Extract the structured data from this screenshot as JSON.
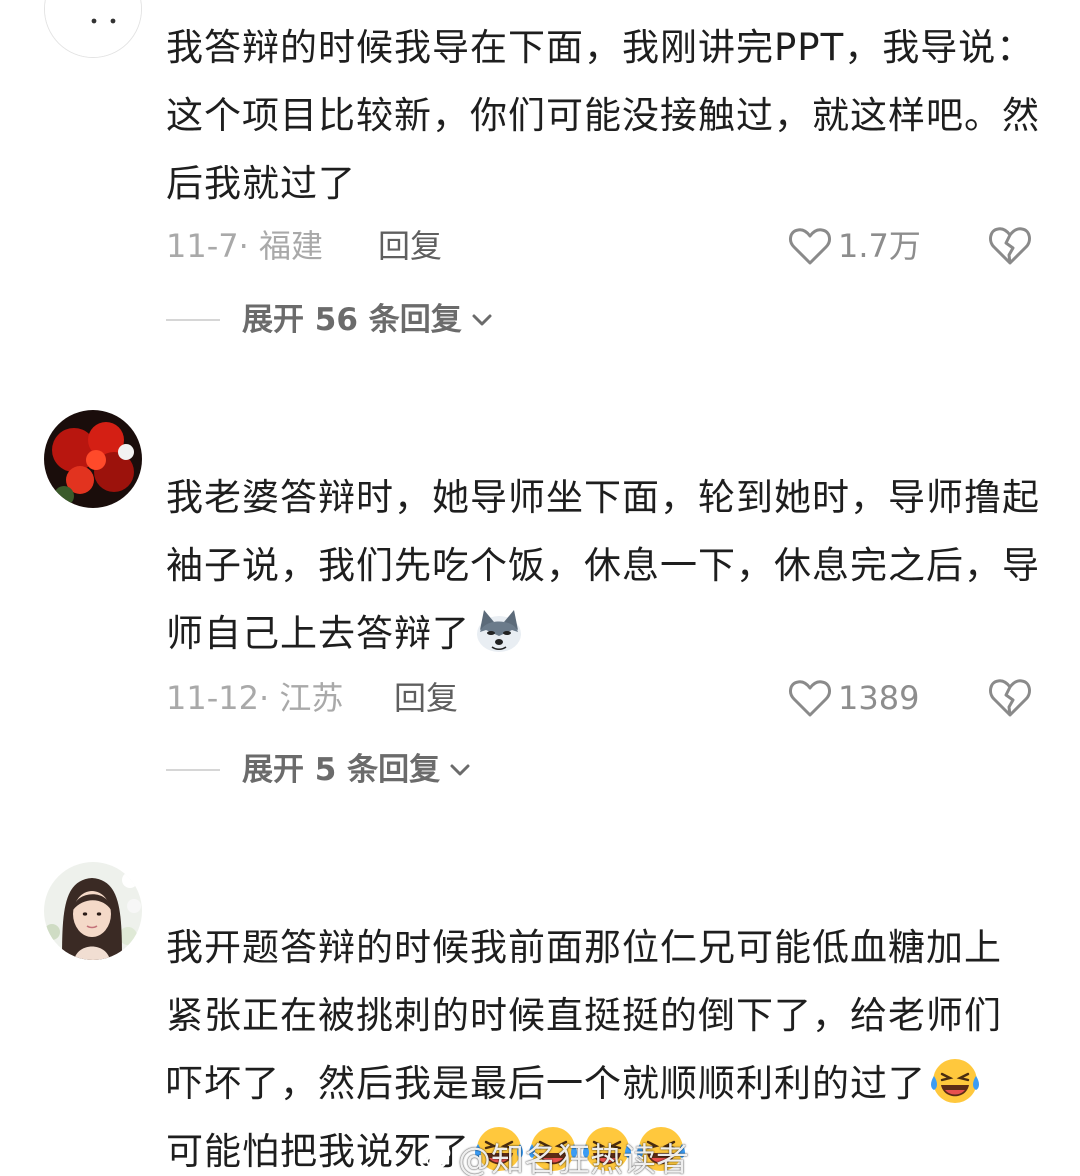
{
  "comments": [
    {
      "text": "我答辩的时候我导在下面，我刚讲完PPT，我导说：这个项目比较新，你们可能没接触过，就这样吧。然后我就过了",
      "date_location": "11-7· 福建",
      "reply_label": "回复",
      "like_count": "1.7万",
      "expand_label": "展开 56 条回复"
    },
    {
      "text": "我老婆答辩时，她导师坐下面，轮到她时，导师撸起袖子说，我们先吃个饭，休息一下，休息完之后，导师自己上去答辩了",
      "emoji_icon": "doge-husky-emoji",
      "date_location": "11-12· 江苏",
      "reply_label": "回复",
      "like_count": "1389",
      "expand_label": "展开 5 条回复"
    },
    {
      "text": "我开题答辩的时候我前面那位仁兄可能低血糖加上紧张正在被挑刺的时候直挺挺的倒下了，给老师们吓坏了，然后我是最后一个就顺顺利利的过了",
      "text_tail": "可能怕把我说死了",
      "emoji_icon": "laughing-crying-emoji"
    }
  ],
  "watermark": "@知名狂热读者",
  "icons": {
    "like": "heart-outline-icon",
    "dislike": "broken-heart-icon",
    "expand": "chevron-down-icon"
  },
  "colors": {
    "text": "#1e1e1e",
    "meta": "#a9a9a9",
    "expand": "#6b6b6b"
  }
}
